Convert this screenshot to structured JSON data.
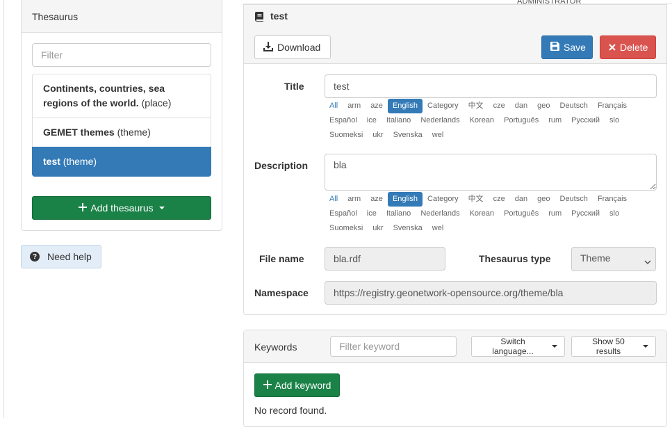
{
  "header": {
    "user_role": "ADMINISTRATOR"
  },
  "sidebar": {
    "heading": "Thesaurus",
    "filter_placeholder": "Filter",
    "items": [
      {
        "name": "Continents, countries, sea regions of the world.",
        "type": "(place)",
        "active": false
      },
      {
        "name": "GEMET themes",
        "type": "(theme)",
        "active": false
      },
      {
        "name": "test",
        "type": "(theme)",
        "active": true
      }
    ],
    "add_label": "Add thesaurus",
    "help_label": "Need help"
  },
  "editor": {
    "title": "test",
    "download_label": "Download",
    "save_label": "Save",
    "delete_label": "Delete",
    "title_label": "Title",
    "title_value": "test",
    "description_label": "Description",
    "description_value": "bla",
    "languages": [
      "All",
      "arm",
      "aze",
      "English",
      "Category",
      "中文",
      "cze",
      "dan",
      "geo",
      "Deutsch",
      "Français",
      "Español",
      "ice",
      "Italiano",
      "Nederlands",
      "Korean",
      "Português",
      "rum",
      "Русский",
      "slo",
      "Suomeksi",
      "ukr",
      "Svenska",
      "wel"
    ],
    "selected_language": "English",
    "file_name_label": "File name",
    "file_name_value": "bla.rdf",
    "thesaurus_type_label": "Thesaurus type",
    "thesaurus_type_value": "Theme",
    "namespace_label": "Namespace",
    "namespace_value": "https://registry.geonetwork-opensource.org/theme/bla"
  },
  "keywords": {
    "heading": "Keywords",
    "filter_placeholder": "Filter keyword",
    "switch_language_label": "Switch language...",
    "show_results_label": "Show 50 results",
    "add_label": "Add keyword",
    "empty_message": "No record found."
  },
  "colors": {
    "primary": "#337ab7",
    "success": "#1a8147",
    "danger": "#d9534f",
    "help_bg": "#e3edf7"
  }
}
